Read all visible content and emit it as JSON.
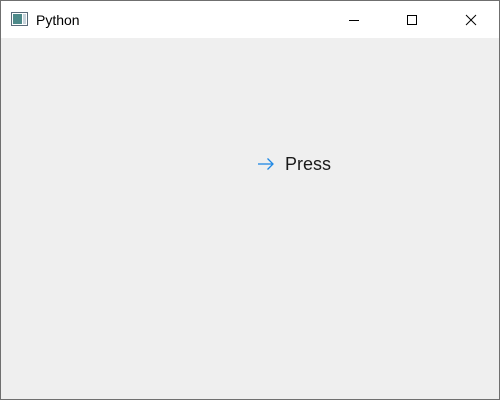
{
  "window": {
    "title": "Python",
    "icon": "python-window-icon"
  },
  "controls": {
    "minimize_icon": "minimize-icon",
    "maximize_icon": "maximize-icon",
    "close_icon": "close-icon"
  },
  "main": {
    "press_button": {
      "label": "Press",
      "icon": "arrow-right-icon",
      "icon_color": "#1e88e5"
    }
  },
  "colors": {
    "titlebar_bg": "#ffffff",
    "client_bg": "#efefef"
  }
}
